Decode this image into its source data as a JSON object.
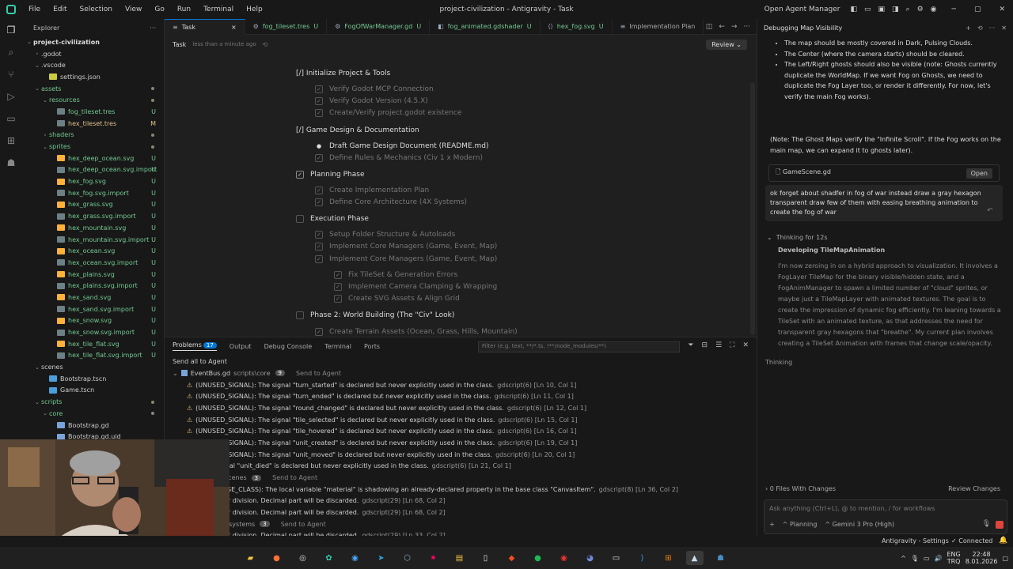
{
  "window": {
    "title": "project-civilization - Antigravity - Task",
    "agent_manager": "Open Agent Manager"
  },
  "menu": [
    "File",
    "Edit",
    "Selection",
    "View",
    "Go",
    "Run",
    "Terminal",
    "Help"
  ],
  "explorer": {
    "title": "Explorer",
    "root": "project-civilization",
    "items": [
      {
        "label": ".godot",
        "kind": "folder",
        "open": false,
        "depth": 1,
        "status": ""
      },
      {
        "label": ".vscode",
        "kind": "folder",
        "open": true,
        "depth": 1,
        "status": ""
      },
      {
        "label": "settings.json",
        "kind": "json",
        "depth": 2,
        "status": ""
      },
      {
        "label": "assets",
        "kind": "folder",
        "open": true,
        "depth": 1,
        "status": "dot"
      },
      {
        "label": "resources",
        "kind": "folder",
        "open": true,
        "depth": 2,
        "status": "dot"
      },
      {
        "label": "fog_tileset.tres",
        "kind": "gear",
        "depth": 3,
        "status": "U"
      },
      {
        "label": "hex_tileset.tres",
        "kind": "gear",
        "depth": 3,
        "status": "M"
      },
      {
        "label": "shaders",
        "kind": "folder",
        "open": false,
        "depth": 2,
        "status": "dot"
      },
      {
        "label": "sprites",
        "kind": "folder",
        "open": true,
        "depth": 2,
        "status": "dot"
      },
      {
        "label": "hex_deep_ocean.svg",
        "kind": "svg",
        "depth": 3,
        "status": "U"
      },
      {
        "label": "hex_deep_ocean.svg.import",
        "kind": "import",
        "depth": 3,
        "status": "U"
      },
      {
        "label": "hex_fog.svg",
        "kind": "svg",
        "depth": 3,
        "status": "U"
      },
      {
        "label": "hex_fog.svg.import",
        "kind": "import",
        "depth": 3,
        "status": "U"
      },
      {
        "label": "hex_grass.svg",
        "kind": "svg",
        "depth": 3,
        "status": "U"
      },
      {
        "label": "hex_grass.svg.import",
        "kind": "import",
        "depth": 3,
        "status": "U"
      },
      {
        "label": "hex_mountain.svg",
        "kind": "svg",
        "depth": 3,
        "status": "U"
      },
      {
        "label": "hex_mountain.svg.import",
        "kind": "import",
        "depth": 3,
        "status": "U"
      },
      {
        "label": "hex_ocean.svg",
        "kind": "svg",
        "depth": 3,
        "status": "U"
      },
      {
        "label": "hex_ocean.svg.import",
        "kind": "import",
        "depth": 3,
        "status": "U"
      },
      {
        "label": "hex_plains.svg",
        "kind": "svg",
        "depth": 3,
        "status": "U"
      },
      {
        "label": "hex_plains.svg.import",
        "kind": "import",
        "depth": 3,
        "status": "U"
      },
      {
        "label": "hex_sand.svg",
        "kind": "svg",
        "depth": 3,
        "status": "U"
      },
      {
        "label": "hex_sand.svg.import",
        "kind": "import",
        "depth": 3,
        "status": "U"
      },
      {
        "label": "hex_snow.svg",
        "kind": "svg",
        "depth": 3,
        "status": "U"
      },
      {
        "label": "hex_snow.svg.import",
        "kind": "import",
        "depth": 3,
        "status": "U"
      },
      {
        "label": "hex_tile_flat.svg",
        "kind": "svg",
        "depth": 3,
        "status": "U"
      },
      {
        "label": "hex_tile_flat.svg.import",
        "kind": "import",
        "depth": 3,
        "status": "U"
      },
      {
        "label": "scenes",
        "kind": "folder",
        "open": true,
        "depth": 1,
        "status": ""
      },
      {
        "label": "Bootstrap.tscn",
        "kind": "scene",
        "depth": 2,
        "status": ""
      },
      {
        "label": "Game.tscn",
        "kind": "scene",
        "depth": 2,
        "status": ""
      },
      {
        "label": "scripts",
        "kind": "folder",
        "open": true,
        "depth": 1,
        "status": "dot"
      },
      {
        "label": "core",
        "kind": "folder",
        "open": true,
        "depth": 2,
        "status": "dot"
      },
      {
        "label": "Bootstrap.gd",
        "kind": "gd",
        "depth": 3,
        "status": ""
      },
      {
        "label": "Bootstrap.gd.uid",
        "kind": "gd",
        "depth": 3,
        "status": ""
      }
    ]
  },
  "tabs": [
    {
      "label": "Task",
      "icon": "≡",
      "active": true,
      "status": "",
      "close": "×"
    },
    {
      "label": "fog_tileset.tres",
      "icon": "⚙",
      "active": false,
      "status": "U",
      "close": ""
    },
    {
      "label": "FogOfWarManager.gd",
      "icon": "⚙",
      "active": false,
      "status": "U",
      "close": ""
    },
    {
      "label": "fog_animated.gdshader",
      "icon": "◧",
      "active": false,
      "status": "U",
      "close": ""
    },
    {
      "label": "hex_fog.svg",
      "icon": "⟨⟩",
      "active": false,
      "status": "U",
      "close": ""
    },
    {
      "label": "Implementation Plan",
      "icon": "≡",
      "active": false,
      "status": "",
      "close": ""
    }
  ],
  "editor": {
    "breadcrumb": "Task",
    "timestamp": "less than a minute ago",
    "review_label": "Review",
    "tasks": [
      {
        "text": "[/] Initialize Project & Tools",
        "kind": "heading",
        "indent": 0
      },
      {
        "text": "Verify Godot MCP Connection",
        "kind": "done",
        "indent": 1
      },
      {
        "text": "Verify Godot Version (4.5.X)",
        "kind": "done",
        "indent": 1
      },
      {
        "text": "Create/Verify  project.godot  existence",
        "kind": "done",
        "indent": 1
      },
      {
        "text": "[/] Game Design & Documentation",
        "kind": "heading",
        "indent": 0
      },
      {
        "text": "Draft Game Design Document (README.md)",
        "kind": "progress",
        "indent": 1
      },
      {
        "text": "Define Rules & Mechanics (Civ 1 x Modern)",
        "kind": "done",
        "indent": 1
      },
      {
        "text": "Planning Phase",
        "kind": "checked-heading",
        "indent": 0
      },
      {
        "text": "Create Implementation Plan",
        "kind": "done",
        "indent": 1
      },
      {
        "text": "Define Core Architecture (4X Systems)",
        "kind": "done",
        "indent": 1
      },
      {
        "text": "Execution Phase",
        "kind": "box-heading",
        "indent": 0
      },
      {
        "text": "Setup Folder Structure & Autoloads",
        "kind": "done",
        "indent": 1
      },
      {
        "text": "Implement Core Managers (Game, Event, Map)",
        "kind": "done",
        "indent": 1
      },
      {
        "text": "Implement Core Managers (Game, Event, Map)",
        "kind": "done",
        "indent": 1
      },
      {
        "text": "Fix TileSet & Generation Errors",
        "kind": "done",
        "indent": 2
      },
      {
        "text": "Implement Camera Clamping & Wrapping",
        "kind": "done",
        "indent": 2
      },
      {
        "text": "Create SVG Assets & Align Grid",
        "kind": "done",
        "indent": 2
      },
      {
        "text": "Phase 2: World Building (The \"Civ\" Look)",
        "kind": "box-heading",
        "indent": 0
      },
      {
        "text": "Create Terrain Assets (Ocean, Grass, Hills, Mountain)",
        "kind": "done",
        "indent": 1
      }
    ]
  },
  "panel": {
    "tabs": [
      "Problems",
      "Output",
      "Debug Console",
      "Terminal",
      "Ports"
    ],
    "problem_count": "17",
    "filter_placeholder": "Filter (e.g. text, **/*.ts, !**/node_modules/**)",
    "send_all": "Send all to Agent",
    "rows": [
      {
        "kind": "file",
        "text": "EventBus.gd",
        "path": "scripts\\core",
        "count": "9",
        "action": "Send to Agent"
      },
      {
        "kind": "warn",
        "text": "(UNUSED_SIGNAL): The signal \"turn_started\" is declared but never explicitly used in the class.",
        "src": "gdscript(6)  [Ln 10, Col 1]"
      },
      {
        "kind": "warn",
        "text": "(UNUSED_SIGNAL): The signal \"turn_ended\" is declared but never explicitly used in the class.",
        "src": "gdscript(6)  [Ln 11, Col 1]"
      },
      {
        "kind": "warn",
        "text": "(UNUSED_SIGNAL): The signal \"round_changed\" is declared but never explicitly used in the class.",
        "src": "gdscript(6)  [Ln 12, Col 1]"
      },
      {
        "kind": "warn",
        "text": "(UNUSED_SIGNAL): The signal \"tile_selected\" is declared but never explicitly used in the class.",
        "src": "gdscript(6)  [Ln 15, Col 1]"
      },
      {
        "kind": "warn",
        "text": "(UNUSED_SIGNAL): The signal \"tile_hovered\" is declared but never explicitly used in the class.",
        "src": "gdscript(6)  [Ln 16, Col 1]"
      },
      {
        "kind": "warn",
        "text": "(UNUSED_SIGNAL): The signal \"unit_created\" is declared but never explicitly used in the class.",
        "src": "gdscript(6)  [Ln 19, Col 1]"
      },
      {
        "kind": "warn",
        "text": "(UNUSED_SIGNAL): The signal \"unit_moved\" is declared but never explicitly used in the class.",
        "src": "gdscript(6)  [Ln 20, Col 1]"
      },
      {
        "kind": "warn",
        "text": "SIGNAL): The signal \"unit_died\" is declared but never explicitly used in the class.",
        "src": "gdscript(6)  [Ln 21, Col 1]"
      },
      {
        "kind": "file",
        "text": "gd",
        "path": "scripts\\scenes",
        "count": "3",
        "action": "Send to Agent"
      },
      {
        "kind": "warn",
        "text": "ED_VARIABLE_BASE_CLASS): The local variable \"material\" is shadowing an already-declared property in the base class \"CanvasItem\".",
        "src": "gdscript(8)  [Ln 36, Col 2]"
      },
      {
        "kind": "warn",
        "text": "DIVISION): Integer division. Decimal part will be discarded.",
        "src": "gdscript(29)  [Ln 68, Col 2]"
      },
      {
        "kind": "warn",
        "text": "DIVISION): Integer division. Decimal part will be discarded.",
        "src": "gdscript(29)  [Ln 68, Col 2]"
      },
      {
        "kind": "file",
        "text": "r.gd",
        "path": "scripts\\systems",
        "count": "3",
        "action": "Send to Agent"
      },
      {
        "kind": "warn",
        "text": "DIVISION): Integer division. Decimal part will be discarded.",
        "src": "gdscript(29)  [Ln 33, Col 2]"
      }
    ]
  },
  "chat": {
    "title": "Debugging Map Visibility",
    "bullets": [
      "The map should be mostly covered in Dark, Pulsing Clouds.",
      "The Center (where the camera starts) should be cleared.",
      "The Left/Right ghosts should also be visible (note: Ghosts currently duplicate the WorldMap. If we want Fog on Ghosts, we need to duplicate the Fog Layer too, or render it differently. For now, let's verify the main Fog works)."
    ],
    "note": "(Note: The Ghost Maps verify the \"Infinite Scroll\". If the Fog works on the main map, we can expand it to ghosts later).",
    "file_card": "GameScene.gd",
    "open_label": "Open",
    "user_message": "ok forget about shadfer in fog of war instead draw a gray hexagon transparent draw few of them with easing breathing animation to create the fog of war",
    "thinking_label": "Thinking for 12s",
    "thinking_title": "Developing TileMapAnimation",
    "thinking_text": "I'm now zeroing in on a hybrid approach to visualization. It involves a FogLayer TileMap for the binary visible/hidden state, and a FogAnimManager to spawn a limited number of \"cloud\" sprites, or maybe just a TileMapLayer with animated textures. The goal is to create the impression of dynamic fog efficiently. I'm leaning towards a TileSet with an animated texture, as that addresses the need for transparent gray hexagons that \"breathe\". My current plan involves creating a TileSet Animation with frames that change scale/opacity.",
    "thinking_status": "Thinking",
    "files_changes": "0 Files With Changes",
    "review_changes": "Review Changes",
    "input_placeholder": "Ask anything (Ctrl+L), @ to mention, / for workflows",
    "mode": "Planning",
    "model": "Gemini 3 Pro (High)"
  },
  "statusbar": {
    "settings": "Antigravity - Settings",
    "connected": "Connected"
  },
  "tray": {
    "lang_top": "ENG",
    "lang_bottom": "TRQ",
    "time": "22:48",
    "date": "8.01.2026"
  }
}
